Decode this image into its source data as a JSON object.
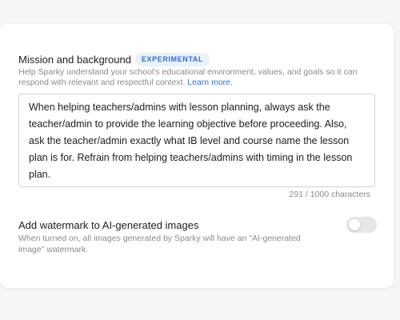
{
  "mission": {
    "title": "Mission and background",
    "badge": "EXPERIMENTAL",
    "help_text": "Help Sparky understand your school's educational environment, values, and goals so it can respond with relevant and respectful context. ",
    "learn_more": "Learn more.",
    "textarea_value": "When helping teachers/admins with lesson planning, always ask the teacher/admin to provide the learning objective before proceeding. Also, ask the teacher/admin exactly what IB level and course name the lesson plan is for. Refrain from helping teachers/admins with timing in the lesson plan.",
    "char_count": "291 / 1000 characters"
  },
  "watermark": {
    "title": "Add watermark to AI-generated images",
    "description": "When turned on, all images generated by Sparky will have an \"AI-generated image\" watermark.",
    "toggle_on": false
  },
  "colors": {
    "accent": "#2f6fd6",
    "badge_bg": "#e9f1fc",
    "muted_text": "#8a8a8e"
  }
}
